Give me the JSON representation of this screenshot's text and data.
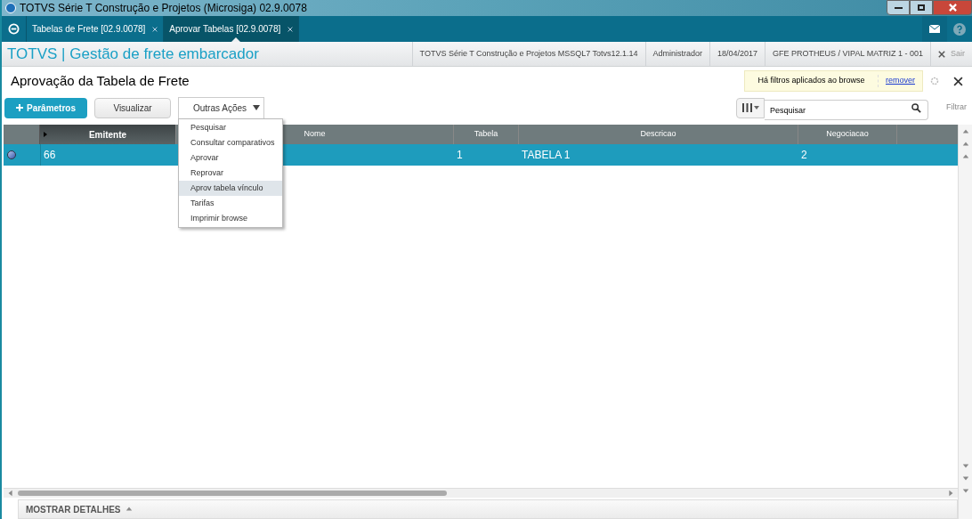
{
  "window": {
    "title": "TOTVS Série T Construção e Projetos (Microsiga) 02.9.0078"
  },
  "tabs": [
    {
      "label": "Tabelas de Frete [02.9.0078]",
      "selected": false
    },
    {
      "label": "Aprovar Tabelas [02.9.0078]",
      "selected": true
    }
  ],
  "header": {
    "brand": "TOTVS | Gestão de frete embarcador",
    "info": [
      "TOTVS Série T Construção e Projetos MSSQL7 Totvs12.1.14",
      "Administrador",
      "18/04/2017",
      "GFE PROTHEUS / VIPAL MATRIZ 1 - 001"
    ],
    "exit": "Sair"
  },
  "page": {
    "title": "Aprovação da Tabela de Frete",
    "filter_notice": "Há filtros aplicados ao browse",
    "filter_remove": "remover"
  },
  "toolbar": {
    "buttons": [
      {
        "label": "Parâmetros",
        "kind": "primary"
      },
      {
        "label": "Visualizar",
        "kind": "default"
      },
      {
        "label": "Outras Ações",
        "kind": "dropdown"
      }
    ],
    "search": {
      "placeholder": "Pesquisar"
    },
    "filter": "Filtrar"
  },
  "menu": [
    {
      "label": "Pesquisar",
      "selected": false
    },
    {
      "label": "Consultar comparativos",
      "selected": false
    },
    {
      "label": "Aprovar",
      "selected": false
    },
    {
      "label": "Reprovar",
      "selected": false
    },
    {
      "label": "Aprov tabela vínculo",
      "selected": true
    },
    {
      "label": "Tarifas",
      "selected": false
    },
    {
      "label": "Imprimir browse",
      "selected": false
    }
  ],
  "table": {
    "columns": [
      "Emitente",
      "Nome",
      "Tabela",
      "Descricao",
      "Negociacao"
    ],
    "rows": [
      {
        "cells": [
          "66",
          "",
          "1",
          "TABELA 1",
          "2"
        ],
        "selected": true
      }
    ]
  },
  "footer": {
    "details": "MOSTRAR DETALHES"
  }
}
